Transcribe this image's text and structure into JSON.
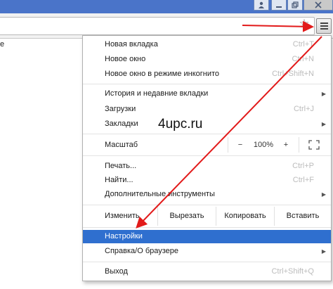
{
  "titlebar": {
    "buttons": [
      "user-icon",
      "minimize-icon",
      "restore-icon",
      "close-icon"
    ]
  },
  "toolbar": {
    "bookmark_icon": "star-icon",
    "menu_icon": "hamburger-menu-icon"
  },
  "page": {
    "edge_text": "e"
  },
  "menu": {
    "items_top": [
      {
        "label": "Новая вкладка",
        "shortcut": "Ctrl+T"
      },
      {
        "label": "Новое окно",
        "shortcut": "Ctrl+N"
      },
      {
        "label": "Новое окно в режиме инкогнито",
        "shortcut": "Ctrl+Shift+N"
      }
    ],
    "items_mid": [
      {
        "label": "История и недавние вкладки",
        "shortcut": ""
      },
      {
        "label": "Загрузки",
        "shortcut": "Ctrl+J"
      },
      {
        "label": "Закладки",
        "shortcut": ""
      }
    ],
    "zoom": {
      "label": "Масштаб",
      "minus": "−",
      "value": "100%",
      "plus": "+"
    },
    "items_tools": [
      {
        "label": "Печать...",
        "shortcut": "Ctrl+P"
      },
      {
        "label": "Найти...",
        "shortcut": "Ctrl+F"
      },
      {
        "label": "Дополнительные инструменты",
        "shortcut": ""
      }
    ],
    "edit": {
      "label": "Изменить",
      "cut": "Вырезать",
      "copy": "Копировать",
      "paste": "Вставить"
    },
    "settings": {
      "label": "Настройки"
    },
    "help": {
      "label": "Справка/О браузере"
    },
    "exit": {
      "label": "Выход",
      "shortcut": "Ctrl+Shift+Q"
    }
  },
  "watermark": "4upc.ru",
  "colors": {
    "highlight": "#2f6fcf",
    "arrow": "#e21a1a",
    "titlebar": "#4a74c9"
  }
}
